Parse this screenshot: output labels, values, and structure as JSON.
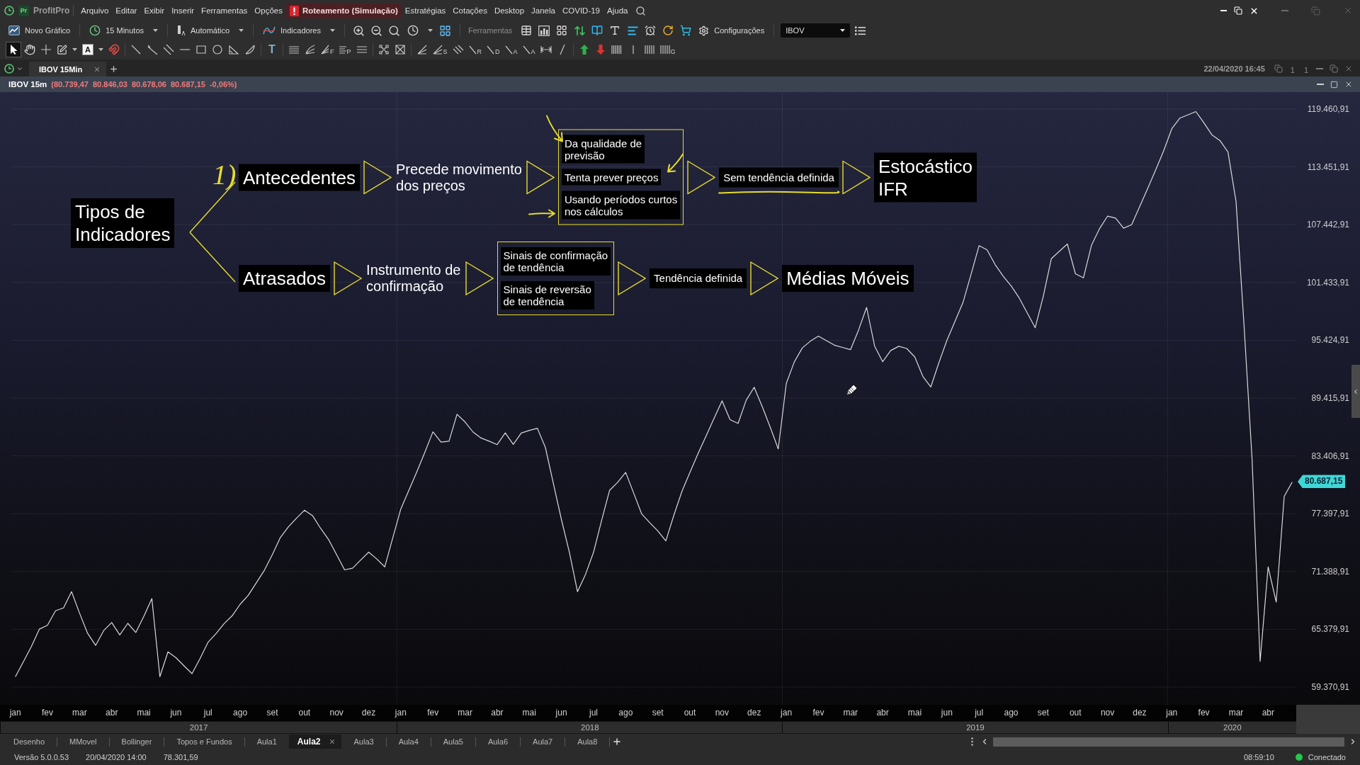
{
  "menu_bar": {
    "logo": "Pr",
    "app_name": "ProfitPro",
    "items": [
      {
        "label": "Arquivo",
        "highlighted": false
      },
      {
        "label": "Editar",
        "highlighted": false
      },
      {
        "label": "Exibir",
        "highlighted": false
      },
      {
        "label": "Inserir",
        "highlighted": false
      },
      {
        "label": "Ferramentas",
        "highlighted": false
      },
      {
        "label": "Opções",
        "highlighted": false
      },
      {
        "label": "Roteamento (Simulação)",
        "highlighted": true
      },
      {
        "label": "Estratégias",
        "highlighted": false
      },
      {
        "label": "Cotações",
        "highlighted": false
      },
      {
        "label": "Desktop",
        "highlighted": false
      },
      {
        "label": "Janela",
        "highlighted": false
      },
      {
        "label": "COVID-19",
        "highlighted": false
      },
      {
        "label": "Ajuda",
        "highlighted": false
      }
    ]
  },
  "toolbar": {
    "new_chart": "Novo Gráfico",
    "interval": "15 Minutos",
    "scale": "Automático",
    "indicators": "Indicadores",
    "tools_label": "Ferramentas",
    "settings": "Configurações",
    "symbol_field": {
      "value": "IBOV"
    }
  },
  "drawing_tools": [
    {
      "kind": "pointer",
      "selected": true
    },
    {
      "kind": "hand",
      "selected": false
    },
    {
      "kind": "crosshair",
      "selected": false
    },
    {
      "kind": "edit",
      "selected": false
    },
    {
      "kind": "text-color",
      "letter": "A",
      "selected": false
    },
    {
      "kind": "magnet",
      "selected": false
    },
    {
      "kind": "trend-line",
      "selected": false
    },
    {
      "kind": "ray",
      "selected": false
    },
    {
      "kind": "channel",
      "selected": false
    },
    {
      "kind": "horizontal-line",
      "selected": false
    },
    {
      "kind": "rectangle",
      "selected": false
    },
    {
      "kind": "ellipse",
      "selected": false
    },
    {
      "kind": "triangle",
      "selected": false
    },
    {
      "kind": "arc",
      "selected": false
    },
    {
      "kind": "text",
      "letter": "T",
      "selected": false
    },
    {
      "kind": "fib-retracement",
      "selected": false
    },
    {
      "kind": "fan",
      "selected": false
    },
    {
      "kind": "fib-fan",
      "letter": "F",
      "selected": false
    },
    {
      "kind": "fib-projection",
      "letter": "P",
      "selected": false
    },
    {
      "kind": "levels",
      "selected": false
    },
    {
      "kind": "nodes",
      "selected": false
    },
    {
      "kind": "nodes-cross",
      "selected": false
    },
    {
      "kind": "angle-lines",
      "selected": false
    },
    {
      "kind": "angle-lines",
      "letter": "S",
      "selected": false
    },
    {
      "kind": "diagonal-lines",
      "selected": false
    },
    {
      "kind": "slant-line",
      "letter": "R",
      "selected": false
    },
    {
      "kind": "slant-line",
      "letter": "D",
      "selected": false
    },
    {
      "kind": "slant-line",
      "letter": "A",
      "selected": false
    },
    {
      "kind": "slant-line",
      "letter": "A",
      "selected": false
    },
    {
      "kind": "measure",
      "selected": false
    },
    {
      "kind": "slash",
      "selected": false
    },
    {
      "kind": "buy-arrow",
      "selected": false
    },
    {
      "kind": "sell-arrow",
      "selected": false
    },
    {
      "kind": "bars",
      "selected": false
    },
    {
      "kind": "bar",
      "selected": false
    },
    {
      "kind": "bars-sparse",
      "selected": false
    },
    {
      "kind": "bars-sparse",
      "letter": "G",
      "selected": false
    }
  ],
  "chart_tabs": [
    {
      "label": "IBOV 15Min",
      "selected": true
    }
  ],
  "chart_window": {
    "timestamp": "22/04/2020 16:45",
    "layout_buttons": [
      "1",
      "1"
    ]
  },
  "chart": {
    "symbol": "IBOV 15m",
    "quote": "(80.739,47 80.846,03 80.678,06 80.687,15 -0,06%)",
    "last_price": "80.687,15",
    "chart_data": {
      "type": "line",
      "grid": true,
      "categories": [
        "jan",
        null,
        null,
        null,
        "fev",
        null,
        null,
        null,
        "mar",
        null,
        null,
        null,
        "abr",
        null,
        null,
        null,
        "mai",
        null,
        null,
        null,
        "jun",
        null,
        null,
        null,
        "jul",
        null,
        null,
        null,
        "ago",
        null,
        null,
        null,
        "set",
        null,
        null,
        null,
        "out",
        null,
        null,
        null,
        "nov",
        null,
        null,
        null,
        "dez",
        null,
        null,
        null,
        "jan",
        null,
        null,
        null,
        "fev",
        null,
        null,
        null,
        "mar",
        null,
        null,
        null,
        "abr",
        null,
        null,
        null,
        "mai",
        null,
        null,
        null,
        "jun",
        null,
        null,
        null,
        "jul",
        null,
        null,
        null,
        "ago",
        null,
        null,
        null,
        "set",
        null,
        null,
        null,
        "out",
        null,
        null,
        null,
        "nov",
        null,
        null,
        null,
        "dez",
        null,
        null,
        null,
        "jan",
        null,
        null,
        null,
        "fev",
        null,
        null,
        null,
        "mar",
        null,
        null,
        null,
        "abr",
        null,
        null,
        null,
        "mai",
        null,
        null,
        null,
        "jun",
        null,
        null,
        null,
        "jul",
        null,
        null,
        null,
        "ago",
        null,
        null,
        null,
        "set",
        null,
        null,
        null,
        "out",
        null,
        null,
        null,
        "nov",
        null,
        null,
        null,
        "dez",
        null,
        null,
        null,
        "jan",
        null,
        null,
        null,
        "fev",
        null,
        null,
        null,
        "mar",
        null,
        null,
        null,
        "abr",
        null,
        null,
        null
      ],
      "values": [
        60440,
        62010,
        63580,
        65400,
        65800,
        67300,
        67600,
        69290,
        67040,
        64950,
        63700,
        65250,
        66090,
        64800,
        66000,
        65050,
        66740,
        68570,
        60450,
        63040,
        62430,
        61580,
        60770,
        62340,
        64040,
        64940,
        65970,
        66790,
        67990,
        68920,
        70210,
        71500,
        73140,
        74920,
        76030,
        76930,
        77760,
        77200,
        75890,
        74720,
        73140,
        71560,
        71730,
        72580,
        73400,
        72690,
        71870,
        74890,
        77900,
        79830,
        81750,
        83800,
        85910,
        84840,
        84940,
        87730,
        86930,
        85880,
        85260,
        84930,
        84580,
        85800,
        84600,
        85780,
        86060,
        86280,
        84300,
        80510,
        76790,
        73330,
        69290,
        71090,
        73400,
        76680,
        79830,
        80660,
        81690,
        79520,
        77360,
        76470,
        75600,
        74570,
        77230,
        79710,
        81680,
        83630,
        85460,
        87300,
        89130,
        87170,
        86780,
        89190,
        90540,
        88530,
        86380,
        84130,
        90950,
        93180,
        94640,
        95340,
        95850,
        95380,
        94920,
        94680,
        94450,
        96490,
        98840,
        94810,
        93200,
        94360,
        94800,
        94570,
        93690,
        91680,
        90570,
        93100,
        95420,
        97390,
        99350,
        102260,
        105260,
        104830,
        103310,
        102090,
        101080,
        99820,
        98270,
        96730,
        100010,
        103900,
        104680,
        105430,
        102340,
        101920,
        105300,
        107020,
        108330,
        108130,
        107080,
        107440,
        109320,
        111220,
        113140,
        115130,
        117420,
        118520,
        118850,
        119200,
        118040,
        116780,
        116190,
        115000,
        109860,
        96970,
        83120,
        62050,
        71870,
        68210,
        79200,
        80690
      ],
      "ylim": [
        57530,
        121228
      ],
      "yticks": [
        {
          "value": 119460.91,
          "label": "119.460,91"
        },
        {
          "value": 113451.91,
          "label": "113.451,91"
        },
        {
          "value": 107442.91,
          "label": "107.442,91"
        },
        {
          "value": 101433.91,
          "label": "101.433,91"
        },
        {
          "value": 95424.91,
          "label": "95.424,91"
        },
        {
          "value": 89415.91,
          "label": "89.415,91"
        },
        {
          "value": 83406.91,
          "label": "83.406,91"
        },
        {
          "value": 77397.91,
          "label": "77.397,91"
        },
        {
          "value": 71388.91,
          "label": "71.388,91"
        },
        {
          "value": 65379.91,
          "label": "65.379,91"
        },
        {
          "value": 59370.91,
          "label": "59.370,91"
        }
      ]
    },
    "years": [
      "2017",
      "2018",
      "2019",
      "2020"
    ],
    "diagram": {
      "root": "Tipos de\nIndicadores",
      "marker": "1)",
      "branches": [
        {
          "label": "Antecedentes",
          "description": "Precede movimento\ndos preços",
          "details": [
            "Da qualidade de\nprevisão",
            "Tenta prever preços",
            "Usando períodos curtos\nnos cálculos"
          ],
          "condition": "Sem tendência definida",
          "examples": "Estocástico\nIFR"
        },
        {
          "label": "Atrasados",
          "description": "Instrumento de\nconfirmação",
          "details": [
            "Sinais de confirmação\nde tendência",
            "Sinais de reversão\nde tendência"
          ],
          "condition": "Tendência definida",
          "examples": "Médias Móveis"
        }
      ]
    }
  },
  "sheet_tabs": [
    {
      "label": "Desenho",
      "selected": false
    },
    {
      "label": "MMovel",
      "selected": false
    },
    {
      "label": "Bollinger",
      "selected": false
    },
    {
      "label": "Topos e Fundos",
      "selected": false
    },
    {
      "label": "Aula1",
      "selected": false
    },
    {
      "label": "Aula2",
      "selected": true
    },
    {
      "label": "Aula3",
      "selected": false
    },
    {
      "label": "Aula4",
      "selected": false
    },
    {
      "label": "Aula5",
      "selected": false
    },
    {
      "label": "Aula6",
      "selected": false
    },
    {
      "label": "Aula7",
      "selected": false
    },
    {
      "label": "Aula8",
      "selected": false
    }
  ],
  "status_bar": {
    "version": "Versão 5.0.0.53",
    "date": "20/04/2020 14:00",
    "value": "78.301,59",
    "time": "08:59:10",
    "connected": true,
    "connection": "Conectado"
  }
}
